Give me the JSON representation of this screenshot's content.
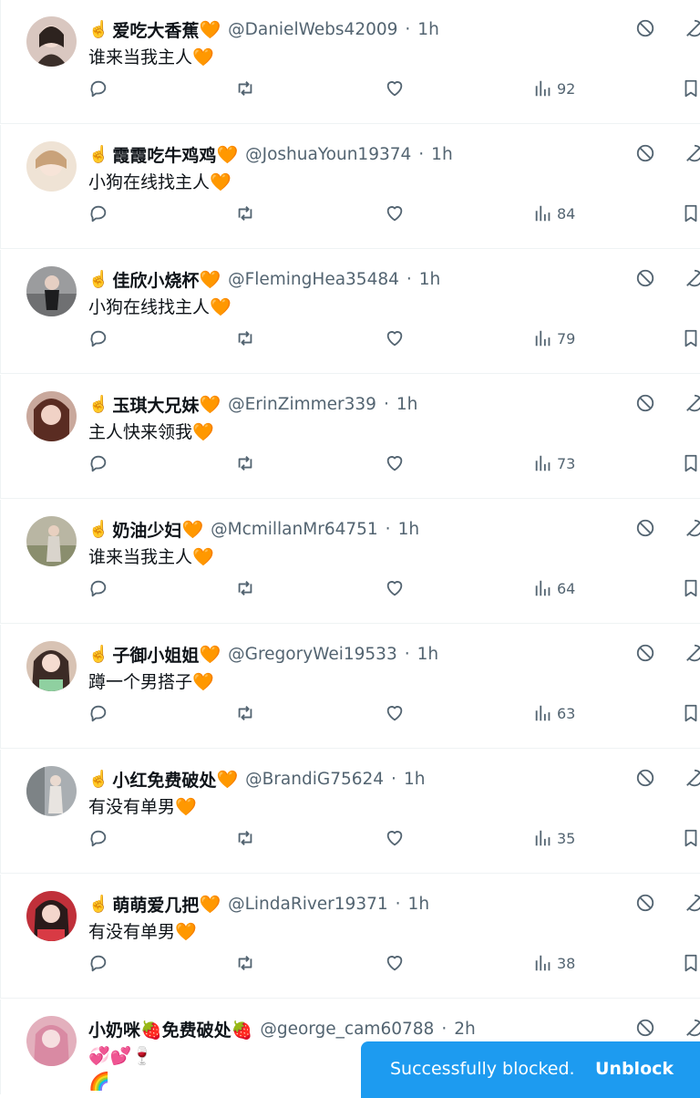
{
  "tweets": [
    {
      "name": "爱吃大香蕉",
      "handle": "@DanielWebs42009",
      "time": "1h",
      "text": "谁来当我主人",
      "views": "92",
      "avatar_color": "#d9c7c0"
    },
    {
      "name": "霞霞吃牛鸡鸡",
      "handle": "@JoshuaYoun19374",
      "time": "1h",
      "text": "小狗在线找主人",
      "views": "84",
      "avatar_color": "#efe3d5"
    },
    {
      "name": "佳欣小烧杯",
      "handle": "@FlemingHea35484",
      "time": "1h",
      "text": "小狗在线找主人",
      "views": "79",
      "avatar_color": "#9b9c9e"
    },
    {
      "name": "玉琪大兄妹",
      "handle": "@ErinZimmer339",
      "time": "1h",
      "text": "主人快来领我",
      "views": "73",
      "avatar_color": "#c9a89c"
    },
    {
      "name": "奶油少妇",
      "handle": "@McmillanMr64751",
      "time": "1h",
      "text": "谁来当我主人",
      "views": "64",
      "avatar_color": "#b9b6a3"
    },
    {
      "name": "子御小姐姐",
      "handle": "@GregoryWei19533",
      "time": "1h",
      "text": "蹲一个男搭子",
      "views": "63",
      "avatar_color": "#d8c3b4"
    },
    {
      "name": "小红免费破处",
      "handle": "@BrandiG75624",
      "time": "1h",
      "text": "有没有单男",
      "views": "35",
      "avatar_color": "#a9aeb2"
    },
    {
      "name": "萌萌爱几把",
      "handle": "@LindaRiver19371",
      "time": "1h",
      "text": "有没有单男",
      "views": "38",
      "avatar_color": "#c0303a"
    }
  ],
  "last_tweet": {
    "name": "小奶咪🍓免费破处🍓",
    "handle": "@george_cam60788",
    "time": "2h",
    "line1": "💞💕🍷",
    "line2": "🌈",
    "avatar_color": "#e3b0bd"
  },
  "toast": {
    "message": "Successfully blocked.",
    "action": "Unblock"
  },
  "icons": {
    "reply": "reply-icon",
    "retweet": "retweet-icon",
    "like": "like-icon",
    "views": "views-icon",
    "bookmark": "bookmark-icon",
    "block": "block-icon",
    "mute": "mute-icon"
  },
  "colors": {
    "accent": "#1d9bf0",
    "muted": "#536471",
    "heart": "#f4900c"
  },
  "glyphs": {
    "hand": "☝️",
    "heart": "🧡",
    "sep": "·"
  }
}
